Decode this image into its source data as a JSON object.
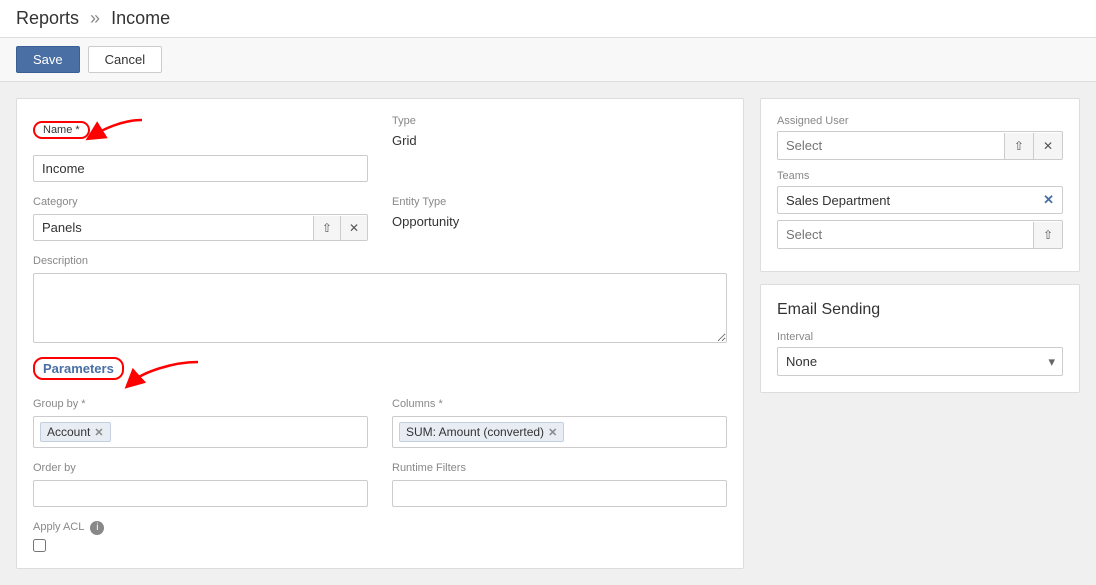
{
  "header": {
    "breadcrumb_reports": "Reports",
    "breadcrumb_sep": "»",
    "breadcrumb_income": "Income"
  },
  "toolbar": {
    "save_label": "Save",
    "cancel_label": "Cancel"
  },
  "form": {
    "name_label": "Name *",
    "name_value": "Income",
    "type_label": "Type",
    "type_value": "Grid",
    "category_label": "Category",
    "category_value": "Panels",
    "entity_type_label": "Entity Type",
    "entity_type_value": "Opportunity",
    "description_label": "Description",
    "description_placeholder": "",
    "parameters_label": "Parameters",
    "group_by_label": "Group by *",
    "group_by_token": "Account",
    "columns_label": "Columns *",
    "columns_token": "SUM: Amount (converted)",
    "order_by_label": "Order by",
    "runtime_filters_label": "Runtime Filters",
    "apply_acl_label": "Apply ACL"
  },
  "right_panel": {
    "assigned_user_label": "Assigned User",
    "assigned_user_placeholder": "Select",
    "teams_label": "Teams",
    "sales_dept": "Sales Department",
    "teams_select_placeholder": "Select",
    "email_sending_title": "Email Sending",
    "interval_label": "Interval",
    "interval_value": "None"
  }
}
